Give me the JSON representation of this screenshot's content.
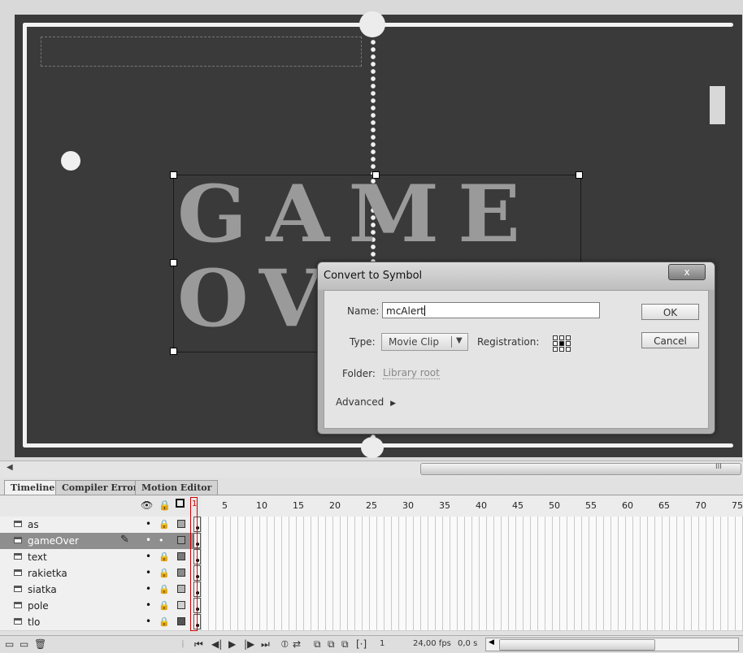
{
  "stage": {
    "game_over_line1": "GAME",
    "game_over_line2": "OVER"
  },
  "dialog": {
    "title": "Convert to Symbol",
    "close_label": "x",
    "name_label": "Name:",
    "name_value": "mcAlert",
    "type_label": "Type:",
    "type_value": "Movie Clip",
    "registration_label": "Registration:",
    "folder_label": "Folder:",
    "folder_value": "Library root",
    "advanced_label": "Advanced",
    "ok_label": "OK",
    "cancel_label": "Cancel"
  },
  "scrollbar": {
    "grip": "III"
  },
  "timeline": {
    "tabs": [
      "Timeline",
      "Compiler Errors",
      "Motion Editor"
    ],
    "current_frame": "1",
    "frame_numbers": [
      "5",
      "10",
      "15",
      "20",
      "25",
      "30",
      "35",
      "40",
      "45",
      "50",
      "55",
      "60",
      "65",
      "70",
      "75"
    ],
    "layers": [
      {
        "name": "as",
        "selected": false
      },
      {
        "name": "gameOver",
        "selected": true
      },
      {
        "name": "text",
        "selected": false
      },
      {
        "name": "rakietka",
        "selected": false
      },
      {
        "name": "siatka",
        "selected": false
      },
      {
        "name": "pole",
        "selected": false
      },
      {
        "name": "tlo",
        "selected": false
      }
    ],
    "status": {
      "frame": "1",
      "fps": "24,00 fps",
      "time": "0,0 s"
    }
  },
  "colors": {
    "stage_bg": "#3a3a3a",
    "selected_layer": "#8e8e8e"
  }
}
